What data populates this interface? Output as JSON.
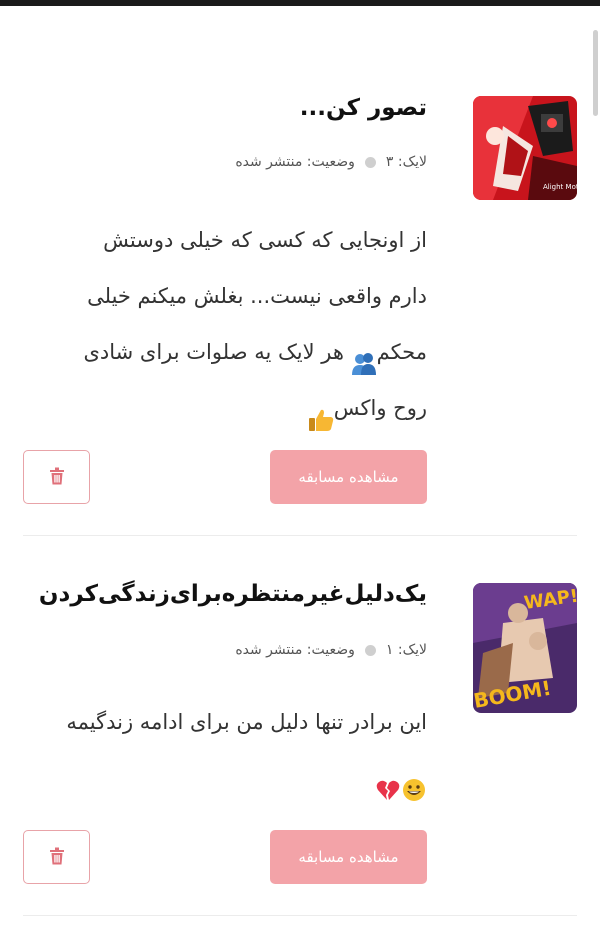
{
  "posts": [
    {
      "title": "تصور کن...",
      "likes_label": "لایک: ۳",
      "status_label": "وضعیت: منتشر شده",
      "body_line1": "از اونجایی که کسی که خیلی دوستش",
      "body_line2": "دارم واقعی نیست... بغلش میکنم خیلی",
      "body_line3_after": " هر لایک یه صلوات برای شادی",
      "body_line3_before": "محکم",
      "body_line4": "روح واکس",
      "view_button": "مشاهده مسابقه",
      "thumb_text": "Alight Motion",
      "icons": [
        "hugging-people-emoji",
        "thumbs-up-emoji",
        "trash-icon"
      ]
    },
    {
      "title": "یک‌دلیل‌غیرمنتظره‌برای‌زندگی‌کردن",
      "likes_label": "لایک: ۱",
      "status_label": "وضعیت: منتشر شده",
      "body_line1": "این برادر تنها دلیل من برای ادامه زندگیمه",
      "view_button": "مشاهده مسابقه",
      "thumb_text_1": "WAP!",
      "thumb_text_2": "BOOM!",
      "icons": [
        "grinning-emoji",
        "broken-heart-emoji",
        "trash-icon"
      ]
    }
  ],
  "colors": {
    "accent_button": "#f3a3a8",
    "delete_border": "#e8a3a8",
    "trash_icon": "#e0707a"
  }
}
